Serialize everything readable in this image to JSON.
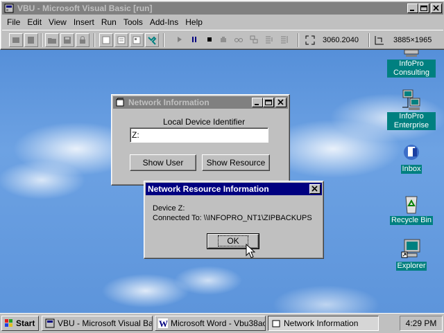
{
  "vb": {
    "title": "VBU - Microsoft Visual Basic [run]",
    "menu": [
      "File",
      "Edit",
      "View",
      "Insert",
      "Run",
      "Tools",
      "Add-Ins",
      "Help"
    ],
    "position_readout": "3060.2040",
    "size_readout": "3885×1965"
  },
  "desktop_icons": [
    {
      "label": "InfoPro Consulting",
      "icon": "network-computer-icon"
    },
    {
      "label": "InfoPro Enterprise",
      "icon": "network-computers-icon"
    },
    {
      "label": "Inbox",
      "icon": "inbox-icon"
    },
    {
      "label": "Recycle Bin",
      "icon": "recycle-bin-icon"
    },
    {
      "label": "Explorer",
      "icon": "explorer-shortcut-icon"
    }
  ],
  "network_window": {
    "title": "Network Information",
    "field_label": "Local Device Identifier",
    "field_value": "Z:",
    "show_user": "Show User",
    "show_resource": "Show Resource"
  },
  "resource_dialog": {
    "title": "Network Resource Information",
    "line1": "Device Z:",
    "line2": "Connected To: \\\\INFOPRO_NT1\\ZIPBACKUPS",
    "ok": "OK"
  },
  "taskbar": {
    "start": "Start",
    "tasks": [
      "VBU - Microsoft Visual Bas...",
      "Microsoft Word - Vbu38ao....",
      "Network Information"
    ],
    "clock": "4:29 PM"
  },
  "colors": {
    "active_title": "#000080",
    "inactive_title": "#808080",
    "desktop_label": "#008080",
    "face": "#c0c0c0"
  }
}
